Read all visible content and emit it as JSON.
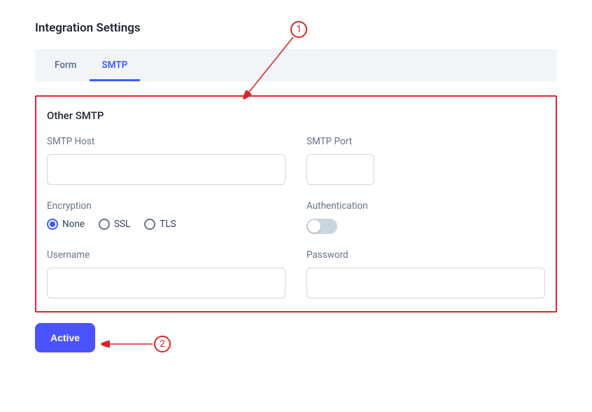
{
  "page_title": "Integration Settings",
  "tabs": {
    "form": "Form",
    "smtp": "SMTP"
  },
  "section_title": "Other SMTP",
  "labels": {
    "smtp_host": "SMTP Host",
    "smtp_port": "SMTP Port",
    "encryption": "Encryption",
    "authentication": "Authentication",
    "username": "Username",
    "password": "Password"
  },
  "encryption_options": {
    "none": "None",
    "ssl": "SSL",
    "tls": "TLS"
  },
  "active_button": "Active",
  "annotations": {
    "one": "1",
    "two": "2"
  }
}
